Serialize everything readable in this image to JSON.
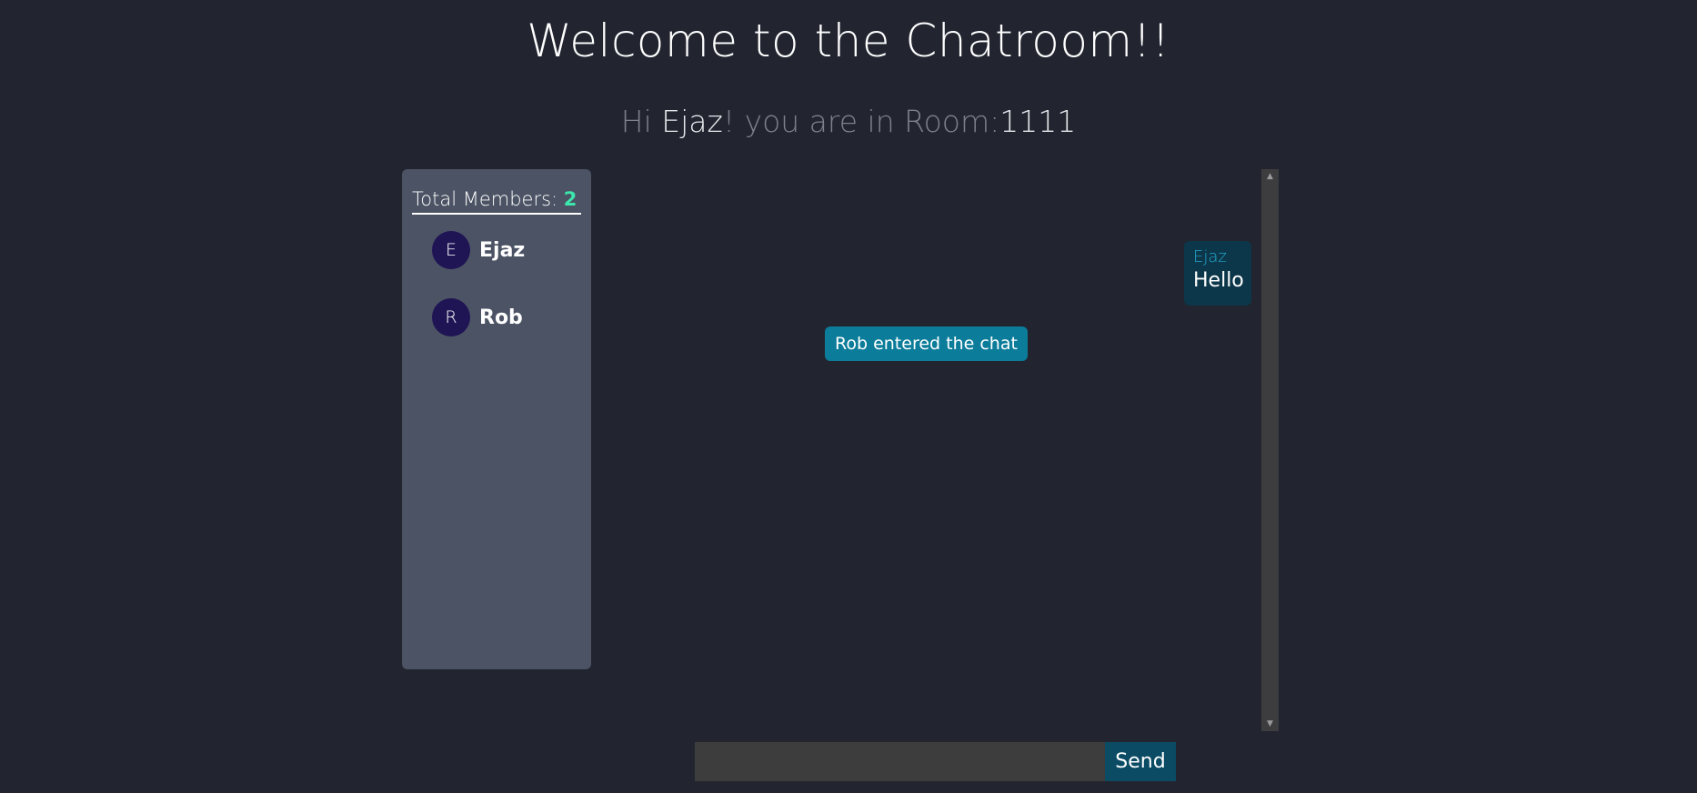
{
  "page": {
    "title": "Welcome to the Chatroom!!"
  },
  "greeting": {
    "prefix": "Hi ",
    "username": "Ejaz",
    "middle": "! you are in Room:",
    "room_id": "1111"
  },
  "members": {
    "label": "Total Members: ",
    "count": "2",
    "list": [
      {
        "initial": "E",
        "name": "Ejaz"
      },
      {
        "initial": "R",
        "name": "Rob"
      }
    ]
  },
  "chat": {
    "system_message": "Rob entered the chat",
    "messages": [
      {
        "sender": "Ejaz",
        "text": "Hello"
      }
    ]
  },
  "composer": {
    "input_value": "",
    "placeholder": "",
    "send_label": "Send"
  },
  "colors": {
    "background": "#222530",
    "panel": "#4b5364",
    "accent_count": "#3ee6ae",
    "avatar": "#1f1454",
    "system_message_bg": "#0b7c9a",
    "bubble_bg": "#0c3649",
    "bubble_sender": "#23a8d2",
    "send_button_bg": "#0b4c64"
  }
}
